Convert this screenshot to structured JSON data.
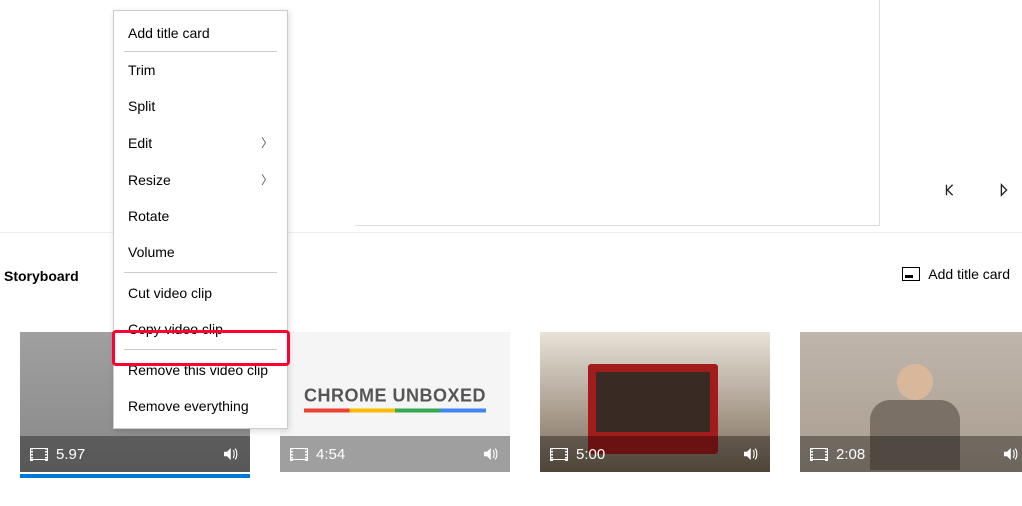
{
  "preview": {
    "prev": "◁",
    "next": "▷"
  },
  "storyboard": {
    "label": "Storyboard",
    "add_title": "Add title card"
  },
  "clips": [
    {
      "duration": "5.97",
      "logo": ""
    },
    {
      "duration": "4:54",
      "logo": "CHROME UNBOXED"
    },
    {
      "duration": "5:00",
      "logo": ""
    },
    {
      "duration": "2:08",
      "logo": ""
    }
  ],
  "menu": {
    "add_title_card": "Add title card",
    "trim": "Trim",
    "split": "Split",
    "edit": "Edit",
    "resize": "Resize",
    "rotate": "Rotate",
    "volume": "Volume",
    "cut": "Cut video clip",
    "copy": "Copy video clip",
    "remove_this": "Remove this video clip",
    "remove_all": "Remove everything"
  }
}
